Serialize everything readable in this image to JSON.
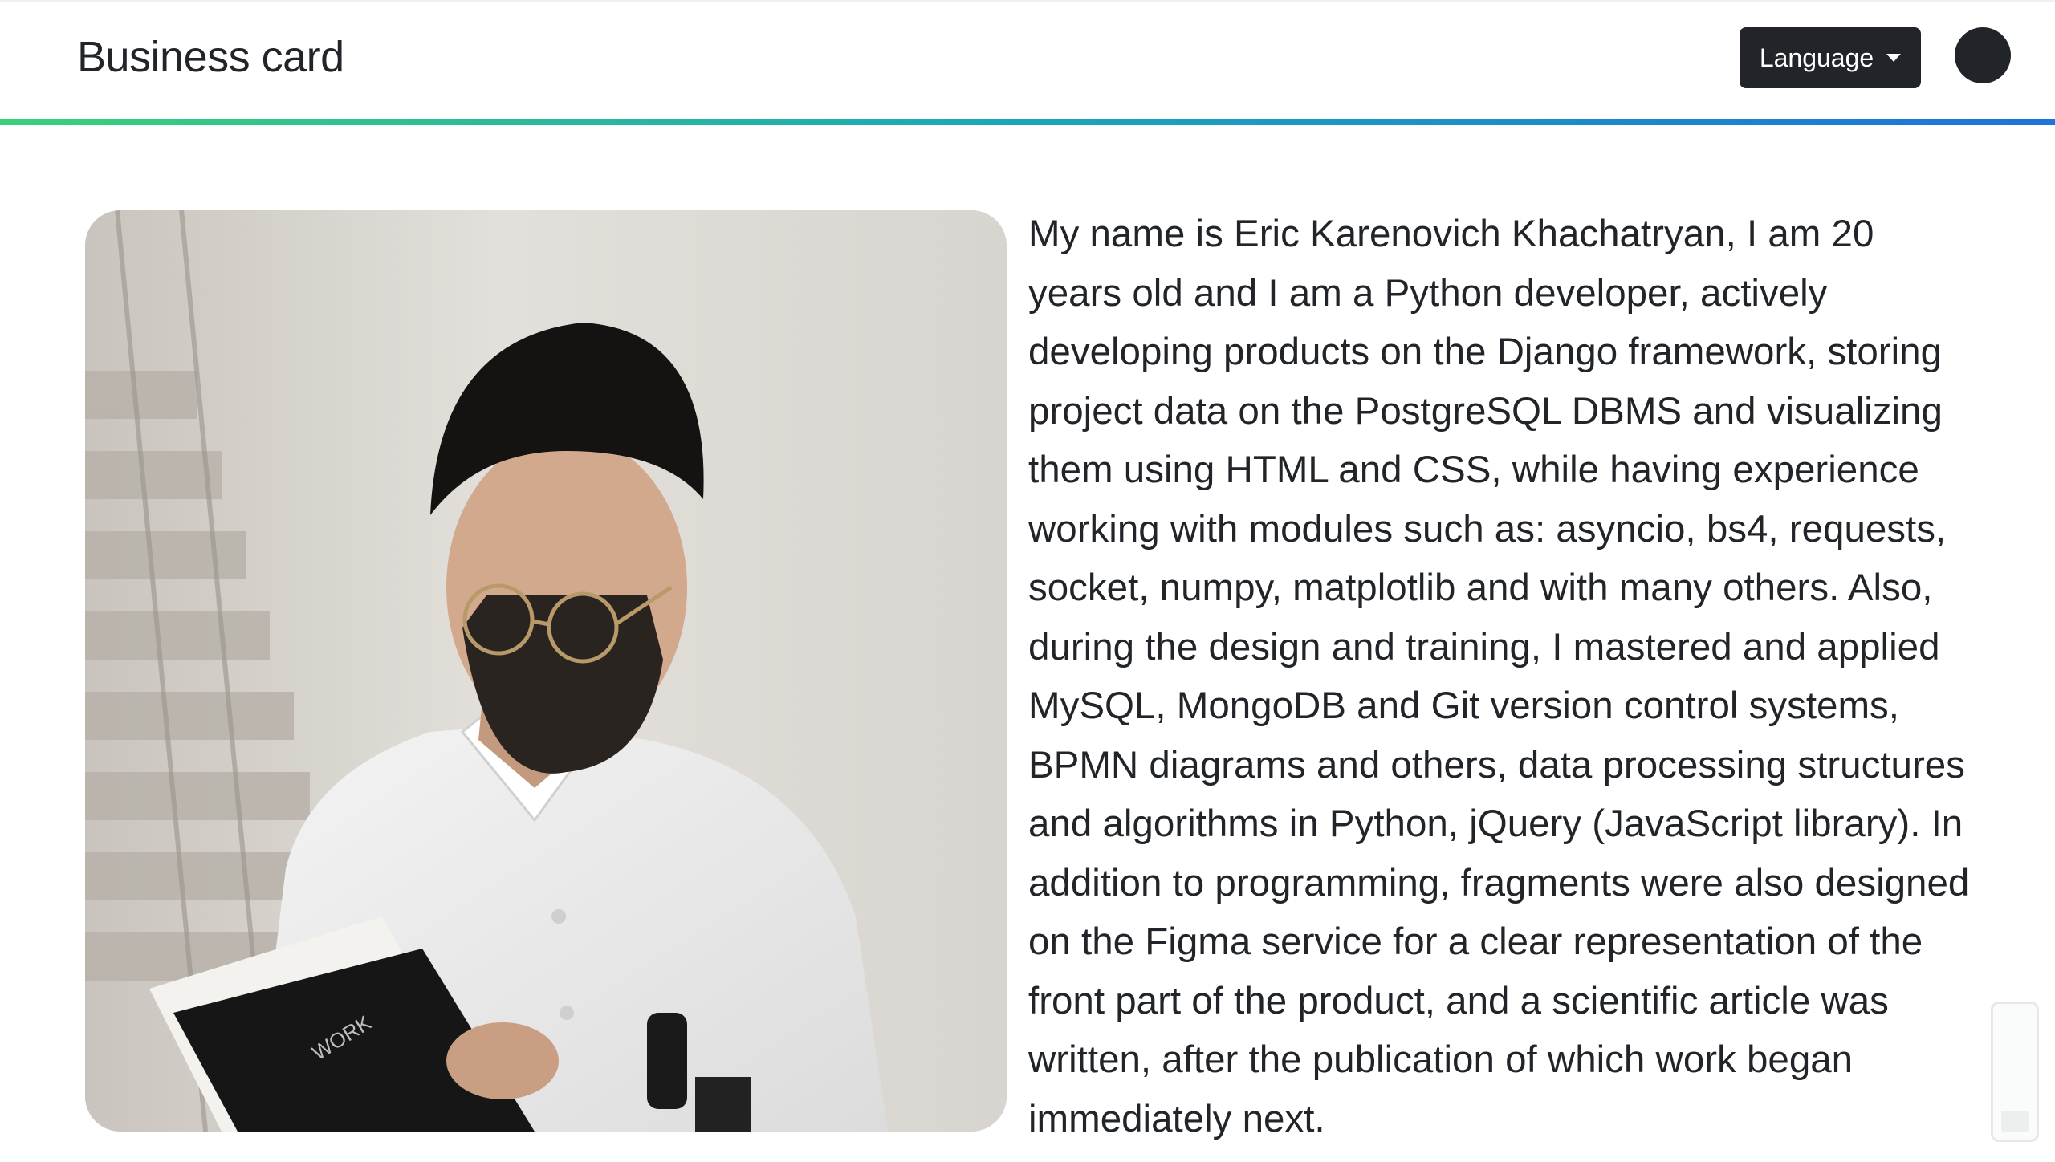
{
  "navbar": {
    "brand": "Business card",
    "language_button": "Language",
    "language_caret_icon": "caret-down-icon",
    "profile_icon": "avatar-circle-icon"
  },
  "colors": {
    "dark": "#212529",
    "accent_start": "#3ad07a",
    "accent_end": "#1e73d8"
  },
  "main": {
    "photo_alt": "Portrait photo",
    "notebook_label": "WORK",
    "bio": "My name is Eric Karenovich Khachatryan, I am 20 years old and I am a Python developer, actively developing products on the Django framework, storing project data on the PostgreSQL DBMS and visualizing them using HTML and CSS, while having experience working with modules such as: asyncio, bs4, requests, socket, numpy, matplotlib and with many others. Also, during the design and training, I mastered and applied MySQL, MongoDB and Git version control systems, BPMN diagrams and others, data processing structures and algorithms in Python, jQuery (JavaScript library). In addition to programming, fragments were also designed on the Figma service for a clear representation of the front part of the product, and a scientific article was written, after the publication of which work began immediately next."
  }
}
